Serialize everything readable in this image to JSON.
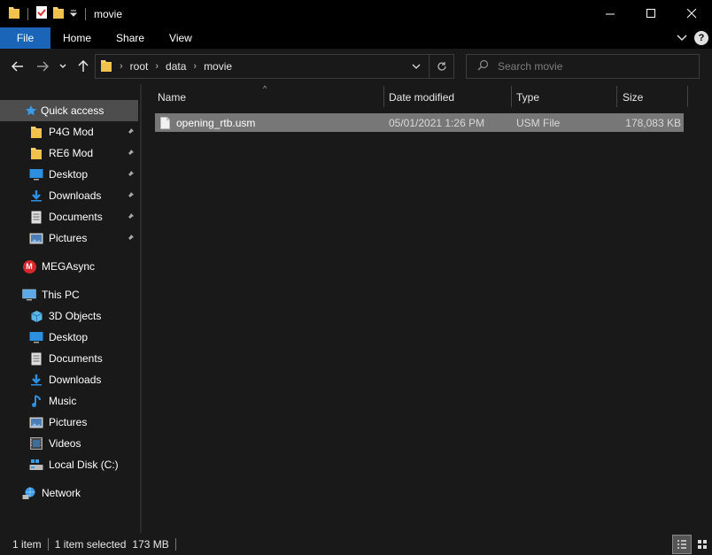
{
  "window": {
    "title": "movie",
    "minimize": "—",
    "maximize": "☐",
    "close": "✕"
  },
  "ribbon": {
    "tabs": [
      "File",
      "Home",
      "Share",
      "View"
    ],
    "expand": "⌄",
    "help": "?"
  },
  "address": {
    "crumbs": [
      "root",
      "data",
      "movie"
    ],
    "separator": "›"
  },
  "search": {
    "placeholder": "Search movie"
  },
  "sidebar": {
    "quick_access": "Quick access",
    "quick_items": [
      "P4G Mod",
      "RE6 Mod",
      "Desktop",
      "Downloads",
      "Documents",
      "Pictures"
    ],
    "megasync": "MEGAsync",
    "mega_letter": "M",
    "this_pc": "This PC",
    "pc_items": [
      "3D Objects",
      "Desktop",
      "Documents",
      "Downloads",
      "Music",
      "Pictures",
      "Videos",
      "Local Disk (C:)"
    ],
    "network": "Network"
  },
  "columns": {
    "name": "Name",
    "date": "Date modified",
    "type": "Type",
    "size": "Size",
    "sort_indicator": "^"
  },
  "files": [
    {
      "name": "opening_rtb.usm",
      "date": "05/01/2021 1:26 PM",
      "type": "USM File",
      "size": "178,083 KB"
    }
  ],
  "status": {
    "count": "1 item",
    "selected": "1 item selected",
    "size": "173 MB"
  },
  "colors": {
    "accent": "#1a65b7",
    "folder": "#f5cf6b",
    "blue_icon": "#2d8fe0",
    "mega": "#d9272e"
  }
}
